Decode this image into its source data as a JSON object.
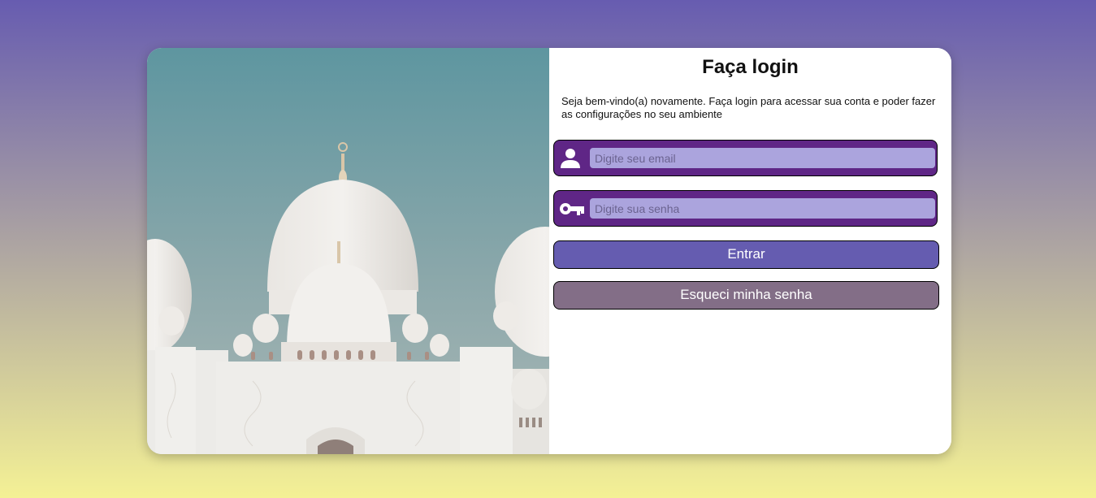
{
  "login": {
    "title": "Faça login",
    "intro": "Seja bem-vindo(a) novamente. Faça login para acessar sua conta e poder fazer as configurações no seu ambiente",
    "email": {
      "placeholder": "Digite seu email",
      "value": "",
      "icon": "user-icon"
    },
    "password": {
      "placeholder": "Digite sua senha",
      "value": "",
      "icon": "key-icon"
    },
    "submit_label": "Entrar",
    "forgot_label": "Esqueci minha senha"
  },
  "colors": {
    "background_top": "#675cb0",
    "background_bottom": "#f4f195",
    "field_background": "#5f2686",
    "input_background": "#aba4dd",
    "primary_button": "#655cb0",
    "secondary_button": "#836e87"
  },
  "image": {
    "subject": "white-mosque-domes"
  }
}
